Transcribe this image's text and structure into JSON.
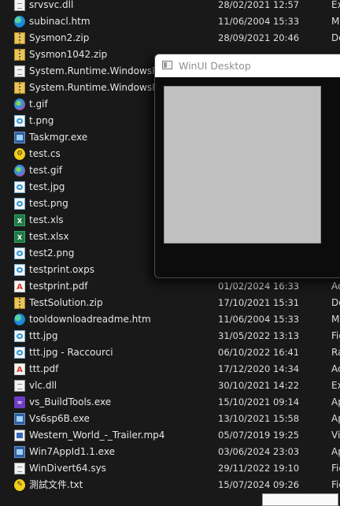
{
  "files": [
    {
      "name": "srvsvc.dll",
      "date": "28/02/2021 12:57",
      "type": "Ex",
      "icon": "dll-file-icon"
    },
    {
      "name": "subinacl.htm",
      "date": "11/06/2004 15:33",
      "type": "M",
      "icon": "edge-html-icon"
    },
    {
      "name": "Sysmon2.zip",
      "date": "28/09/2021 20:46",
      "type": "Do",
      "icon": "zip-folder-icon"
    },
    {
      "name": "Sysmon1042.zip",
      "date": "",
      "type": "",
      "icon": "zip-folder-icon"
    },
    {
      "name": "System.Runtime.WindowsRun",
      "date": "",
      "type": "",
      "icon": "dll-file-icon"
    },
    {
      "name": "System.Runtime.WindowsRun",
      "date": "",
      "type": "",
      "icon": "zip-folder-icon"
    },
    {
      "name": "t.gif",
      "date": "",
      "type": "",
      "icon": "gif-image-icon"
    },
    {
      "name": "t.png",
      "date": "",
      "type": "",
      "icon": "png-image-icon"
    },
    {
      "name": "Taskmgr.exe",
      "date": "",
      "type": "",
      "icon": "exe-app-icon"
    },
    {
      "name": "test.cs",
      "date": "",
      "type": "",
      "icon": "csharp-file-icon"
    },
    {
      "name": "test.gif",
      "date": "",
      "type": "",
      "icon": "gif-image-icon"
    },
    {
      "name": "test.jpg",
      "date": "",
      "type": "",
      "icon": "jpg-image-icon"
    },
    {
      "name": "test.png",
      "date": "",
      "type": "",
      "icon": "png-image-icon"
    },
    {
      "name": "test.xls",
      "date": "",
      "type": "",
      "icon": "excel-file-icon"
    },
    {
      "name": "test.xlsx",
      "date": "",
      "type": "",
      "icon": "excel-file-icon"
    },
    {
      "name": "test2.png",
      "date": "",
      "type": "",
      "icon": "png-image-icon"
    },
    {
      "name": "testprint.oxps",
      "date": "",
      "type": "",
      "icon": "oxps-file-icon"
    },
    {
      "name": "testprint.pdf",
      "date": "01/02/2024 16:33",
      "type": "Ac",
      "icon": "pdf-file-icon"
    },
    {
      "name": "TestSolution.zip",
      "date": "17/10/2021 15:31",
      "type": "Do",
      "icon": "zip-folder-icon"
    },
    {
      "name": "tooldownloadreadme.htm",
      "date": "11/06/2004 15:33",
      "type": "M",
      "icon": "edge-html-icon"
    },
    {
      "name": "ttt.jpg",
      "date": "31/05/2022 13:13",
      "type": "Fic",
      "icon": "jpg-image-icon"
    },
    {
      "name": "ttt.jpg - Raccourci",
      "date": "06/10/2022 16:41",
      "type": "Ra",
      "icon": "shortcut-image-icon"
    },
    {
      "name": "ttt.pdf",
      "date": "17/12/2020 14:34",
      "type": "Ac",
      "icon": "pdf-file-icon"
    },
    {
      "name": "vlc.dll",
      "date": "30/10/2021 14:22",
      "type": "Ex",
      "icon": "dll-file-icon"
    },
    {
      "name": "vs_BuildTools.exe",
      "date": "15/10/2021 09:14",
      "type": "Ap",
      "icon": "visual-studio-icon"
    },
    {
      "name": "Vs6sp6B.exe",
      "date": "13/10/2021 15:58",
      "type": "Ap",
      "icon": "setup-exe-icon"
    },
    {
      "name": "Western_World_-_Trailer.mp4",
      "date": "05/07/2019 19:25",
      "type": "Vi",
      "icon": "video-file-icon"
    },
    {
      "name": "Win7AppId1.1.exe",
      "date": "03/06/2024 23:03",
      "type": "Ap",
      "icon": "exe-app-icon"
    },
    {
      "name": "WinDivert64.sys",
      "date": "29/11/2022 19:10",
      "type": "Fic",
      "icon": "sys-file-icon"
    },
    {
      "name": "測試文件.txt",
      "date": "15/07/2024 09:26",
      "type": "Fic",
      "icon": "text-file-icon"
    }
  ],
  "window": {
    "title": "WinUI Desktop"
  },
  "colors": {
    "background": "#191919",
    "canvas": "#c0c0c0",
    "window_body": "#0c0c0c"
  }
}
